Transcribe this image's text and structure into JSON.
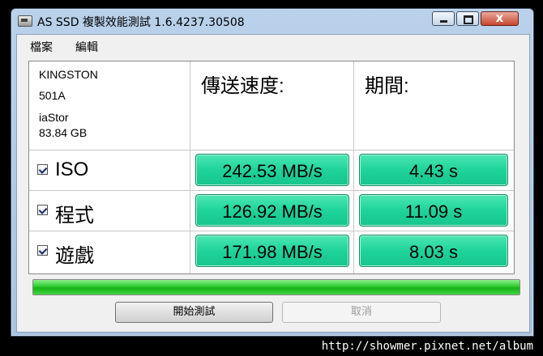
{
  "window": {
    "title": "AS SSD 複製效能測試 1.6.4237.30508",
    "close_glyph": "x"
  },
  "menu": {
    "file": "檔案",
    "edit": "編輯"
  },
  "drive": {
    "model": "KINGSTON",
    "firmware": "501A",
    "driver": "iaStor",
    "size": "83.84 GB"
  },
  "headers": {
    "speed": "傳送速度:",
    "duration": "期間:"
  },
  "rows": [
    {
      "label": "ISO",
      "checked": true,
      "speed": "242.53 MB/s",
      "duration": "4.43 s"
    },
    {
      "label": "程式",
      "checked": true,
      "speed": "126.92 MB/s",
      "duration": "11.09 s"
    },
    {
      "label": "遊戲",
      "checked": true,
      "speed": "171.98 MB/s",
      "duration": "8.03 s"
    }
  ],
  "progress": {
    "value": 1.0
  },
  "buttons": {
    "start": "開始測試",
    "cancel": "取消"
  },
  "watermark": "http://showmer.pixnet.net/album"
}
